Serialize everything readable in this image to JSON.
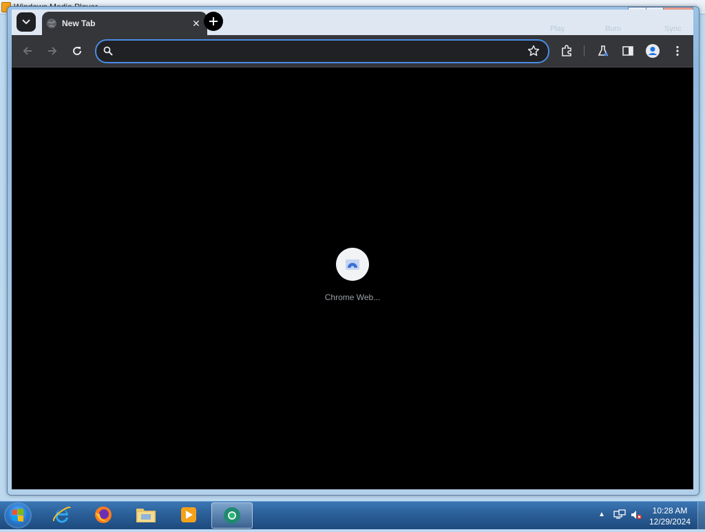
{
  "background_window": {
    "title": "Windows Media Player"
  },
  "browser": {
    "tab": {
      "title": "New Tab",
      "close_glyph": "✕"
    },
    "new_tab_glyph": "+",
    "omnibox": {
      "value": "",
      "placeholder": ""
    },
    "background_menu_faint": [
      "Play",
      "Burn",
      "Sync"
    ],
    "toolbar_icons": [
      "back-arrow-icon",
      "forward-arrow-icon",
      "reload-icon",
      "bookmark-star-icon",
      "extensions-puzzle-icon",
      "labs-flask-icon",
      "side-panel-icon",
      "profile-avatar-icon",
      "more-vert-icon"
    ]
  },
  "new_tab_page": {
    "shortcut_label": "Chrome Web..."
  },
  "taskbar": {
    "apps": [
      "internet-explorer-icon",
      "firefox-icon",
      "file-explorer-icon",
      "windows-media-player-icon",
      "chrome-icon"
    ],
    "clock_time": "10:28 AM",
    "clock_date": "12/29/2024"
  },
  "colors": {
    "accent": "#4b8ce8",
    "toolbar": "#35363a",
    "page": "#000000"
  }
}
